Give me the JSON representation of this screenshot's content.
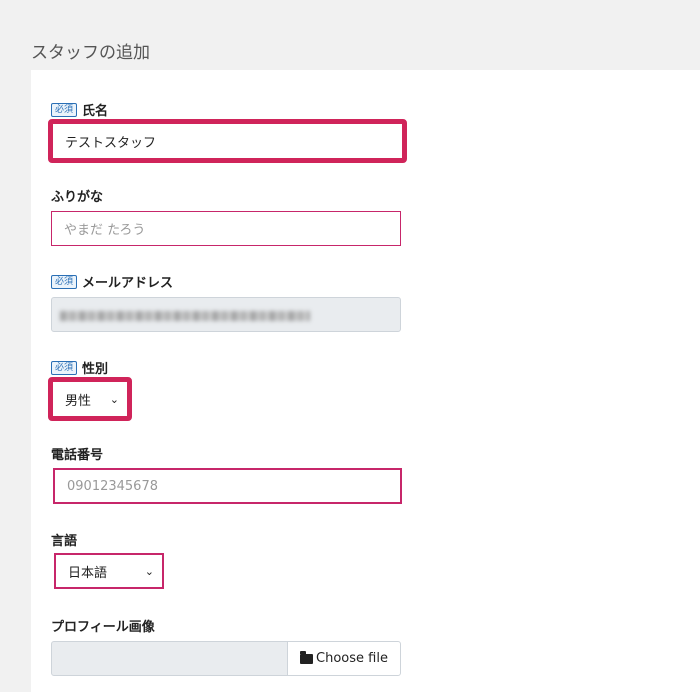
{
  "page": {
    "title": "スタッフの追加"
  },
  "form": {
    "required_badge": "必須",
    "name": {
      "label": "氏名",
      "value": "テストスタッフ"
    },
    "furigana": {
      "label": "ふりがな",
      "placeholder": "やまだ たろう"
    },
    "email": {
      "label": "メールアドレス"
    },
    "gender": {
      "label": "性別",
      "value": "男性"
    },
    "phone": {
      "label": "電話番号",
      "placeholder": "09012345678"
    },
    "language": {
      "label": "言語",
      "value": "日本語"
    },
    "profile_image": {
      "label": "プロフィール画像",
      "button_label": "Choose file"
    }
  },
  "icons": {
    "select_arrow": "chevron-down-icon",
    "file_button": "folder-open-icon"
  },
  "colors": {
    "highlight": "#d0245a",
    "required_badge": "#2a6fb5"
  }
}
